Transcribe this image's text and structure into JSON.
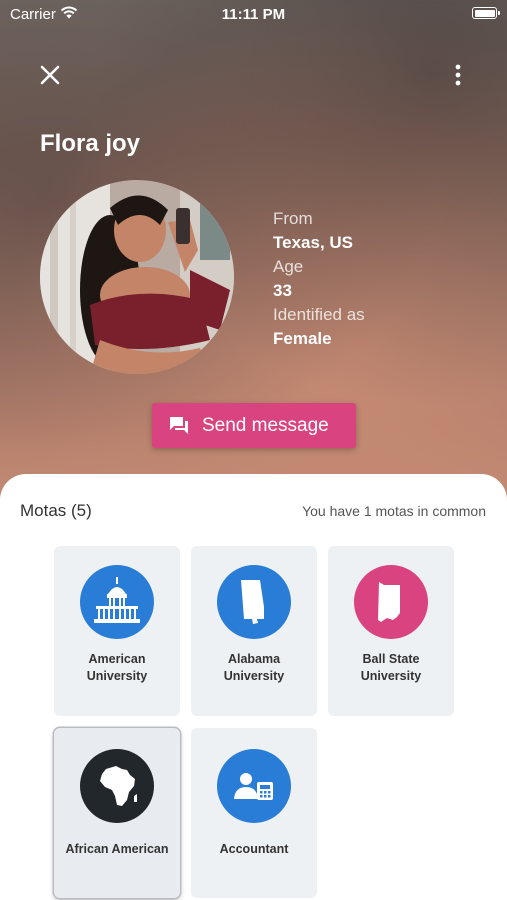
{
  "status_bar": {
    "carrier": "Carrier",
    "time": "11:11 PM"
  },
  "profile": {
    "name": "Flora joy",
    "from_label": "From",
    "from_value": "Texas, US",
    "age_label": "Age",
    "age_value": "33",
    "identified_label": "Identified as",
    "identified_value": "Female",
    "send_button": "Send message"
  },
  "motas": {
    "title": "Motas (5)",
    "common_text": "You have 1 motas in common",
    "items": [
      {
        "label_line1": "American",
        "label_line2": "University",
        "icon": "capitol-building-icon",
        "color": "#2a7dd6"
      },
      {
        "label_line1": "Alabama",
        "label_line2": "University",
        "icon": "alabama-map-icon",
        "color": "#2a7dd6"
      },
      {
        "label_line1": "Ball State",
        "label_line2": "University",
        "icon": "indiana-map-icon",
        "color": "#d9437f"
      },
      {
        "label_line1": "African American",
        "label_line2": "",
        "icon": "africa-map-icon",
        "color": "#22272b",
        "selected": true
      },
      {
        "label_line1": "Accountant",
        "label_line2": "",
        "icon": "accountant-icon",
        "color": "#2a7dd6"
      }
    ]
  },
  "colors": {
    "accent": "#d9437f",
    "blue": "#2a7dd6"
  }
}
